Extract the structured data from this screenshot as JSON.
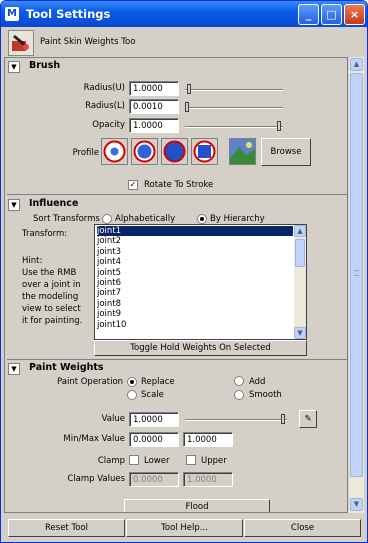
{
  "window": {
    "title": "Tool Settings",
    "controls": [
      "_",
      "□",
      "×"
    ]
  },
  "tool": {
    "name": "Paint Skin Weights Too"
  },
  "brush": {
    "title": "Brush",
    "radius_u_label": "Radius(U)",
    "radius_u_value": "1.0000",
    "radius_l_label": "Radius(L)",
    "radius_l_value": "0.0010",
    "opacity_label": "Opacity",
    "opacity_value": "1.0000",
    "profile_label": "Profile",
    "browse_label": "Browse",
    "rotate_label": "Rotate To Stroke"
  },
  "influence": {
    "title": "Influence",
    "sort_label": "Sort Transforms",
    "sort_alpha": "Alphabetically",
    "sort_hier": "By Hierarchy",
    "transform_label": "Transform:",
    "hint_lines": [
      "Hint:",
      "Use the RMB",
      "over a joint in",
      "the modeling",
      "view to select",
      "it for painting."
    ],
    "joints": [
      "joint1",
      "joint2",
      "joint3",
      "joint4",
      "joint5",
      "joint6",
      "joint7",
      "joint8",
      "joint9",
      "joint10"
    ],
    "toggle_label": "Toggle Hold Weights On Selected"
  },
  "paint_weights": {
    "title": "Paint Weights",
    "op_label": "Paint Operation",
    "op_replace": "Replace",
    "op_add": "Add",
    "op_scale": "Scale",
    "op_smooth": "Smooth",
    "value_label": "Value",
    "value_value": "1.0000",
    "minmax_label": "Min/Max Value",
    "min_value": "0.0000",
    "max_value": "1.0000",
    "clamp_label": "Clamp",
    "clamp_lower": "Lower",
    "clamp_upper": "Upper",
    "clamp_values_label": "Clamp Values",
    "clamp_low_value": "0.0000",
    "clamp_high_value": "1.0000",
    "flood_label": "Flood"
  },
  "footer": {
    "reset": "Reset Tool",
    "help": "Tool Help...",
    "close": "Close"
  },
  "colors": {
    "titlebar": "#0a49d2",
    "selection": "#0a246a",
    "window_bg": "#d4d0c8"
  },
  "slider_levels": {
    "radius_u": 0.02,
    "radius_l": 0.0,
    "opacity": 1.0,
    "value": 1.0
  }
}
